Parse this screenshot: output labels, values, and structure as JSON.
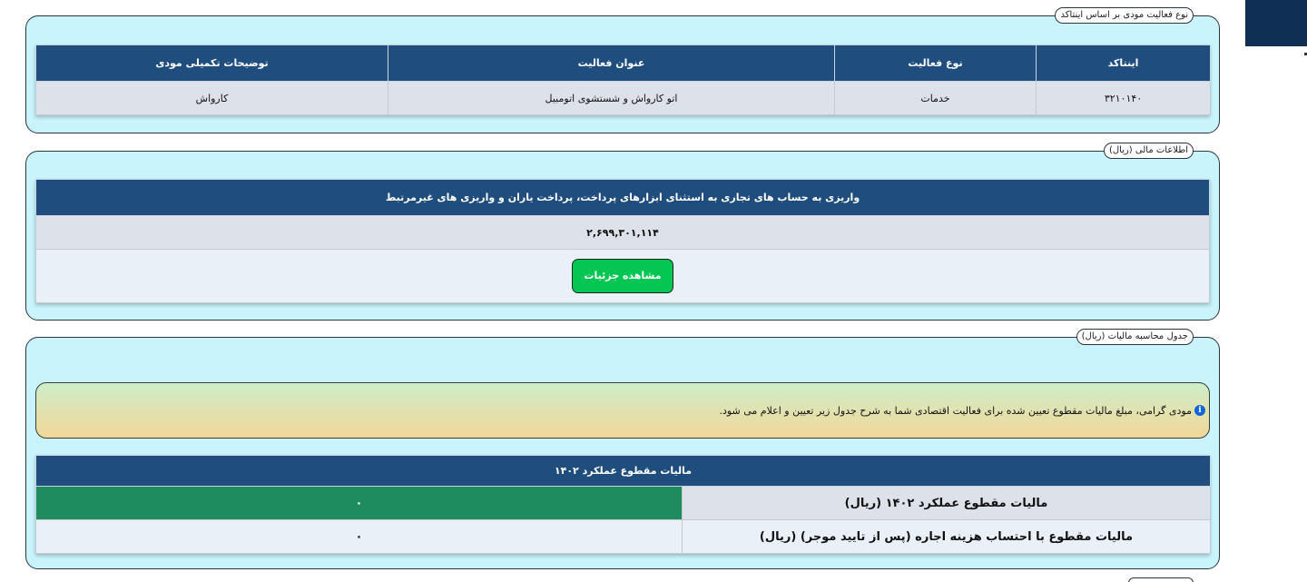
{
  "activity_panel": {
    "title": "نوع فعالیت مودی بر اساس اینتاکد",
    "headers": [
      "اینتاکد",
      "نوع فعالیت",
      "عنوان فعالیت",
      "توضیحات تکمیلی مودی"
    ],
    "row": {
      "intacode": "۳۲۱۰۱۴۰",
      "activity_type": "خدمات",
      "activity_title": "اتو کارواش و شستشوی اتومبیل",
      "extra_desc": "کارواش"
    }
  },
  "financial_panel": {
    "title": "اطلاعات مالی (ریال)",
    "header": "واریزی به حساب های تجاری به استثنای ابزارهای پرداخت، پرداخت یاران و واریزی های غیرمرتبط",
    "amount": "۲,۶۹۹,۳۰۱,۱۱۴",
    "details_button": "مشاهده جزئیات"
  },
  "tax_panel": {
    "title": "جدول محاسبه مالیات (ریال)",
    "notice": "مودی گرامی، مبلغ مالیات مقطوع تعیین شده برای فعالیت اقتصادی شما به شرح جدول زیر تعیین و اعلام می شود.",
    "table_header": "مالیات مقطوع عملکرد ۱۴۰۲",
    "rows": [
      {
        "label": "مالیات مقطوع عملکرد ۱۴۰۲ (ریال)",
        "value": "۰"
      },
      {
        "label": "مالیات مقطوع با احتساب هزینه اجاره (پس از تایید موجر) (ریال)",
        "value": "۰"
      }
    ]
  },
  "icons": {
    "info": "info-icon"
  },
  "colors": {
    "header_blue": "#1f4e7e",
    "panel_bg": "#c9f4fc",
    "button_green": "#06c653",
    "value_green": "#1e8c5e",
    "corner_navy": "#0f2f55"
  }
}
